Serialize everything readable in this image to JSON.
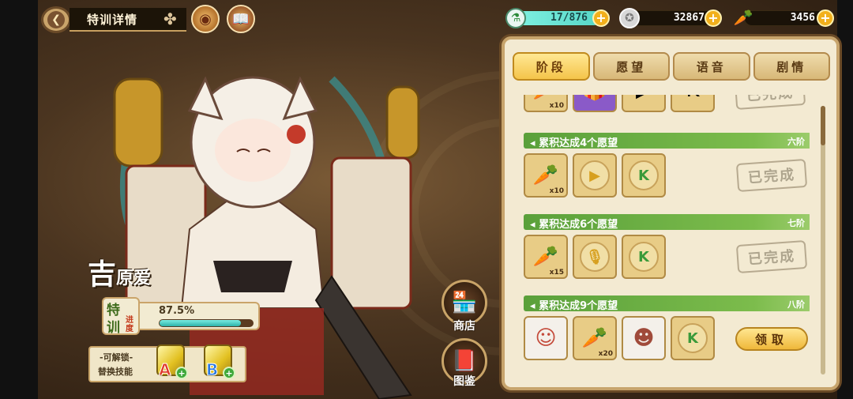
{
  "header": {
    "back_icon": "back-arrow-icon",
    "title": "特训详情",
    "icons": [
      "clover-icon",
      "eye-emblem-icon",
      "book-icon"
    ]
  },
  "currency": {
    "stamina": {
      "icon": "potion-icon",
      "value": "17/876"
    },
    "coin": {
      "icon": "silver-coin-icon",
      "value": "32867"
    },
    "carrot": {
      "icon": "carrot-icon",
      "value": "3456"
    }
  },
  "character": {
    "name_big": "吉",
    "name_small": "原爱",
    "progress_tag_1": "特",
    "progress_tag_2": "训",
    "progress_tag_3": "进度",
    "progress_text": "87.5%",
    "progress_value": 0.875
  },
  "unlock": {
    "line1": "-可解锁-",
    "line2": "替换技能",
    "skills": [
      {
        "letter": "A",
        "color": "#e03a2a"
      },
      {
        "letter": "B",
        "color": "#2a78e0"
      }
    ]
  },
  "side_buttons": {
    "shop_label": "商店",
    "gallery_label": "图鉴"
  },
  "tabs": [
    "阶段",
    "愿望",
    "语音",
    "剧情"
  ],
  "active_tab": 0,
  "stages": [
    {
      "title": "累积达成4个愿望",
      "stage": "六阶",
      "items": [
        {
          "icon": "carrot-icon",
          "count": "x10",
          "glyph": "🥕"
        },
        {
          "icon": "play-icon",
          "count": "",
          "glyph": "▶"
        },
        {
          "icon": "k-badge-icon",
          "count": "",
          "glyph": "K"
        }
      ],
      "status": "已完成"
    },
    {
      "title": "累积达成6个愿望",
      "stage": "七阶",
      "items": [
        {
          "icon": "carrot-icon",
          "count": "x15",
          "glyph": "🥕"
        },
        {
          "icon": "microphone-icon",
          "count": "",
          "glyph": "🎙"
        },
        {
          "icon": "k-badge-icon",
          "count": "",
          "glyph": "K"
        }
      ],
      "status": "已完成"
    },
    {
      "title": "累积达成9个愿望",
      "stage": "八阶",
      "items": [
        {
          "icon": "character-portrait-icon",
          "count": "",
          "glyph": "☺"
        },
        {
          "icon": "carrot-icon",
          "count": "x20",
          "glyph": "🥕"
        },
        {
          "icon": "chibi-character-icon",
          "count": "",
          "glyph": "☻"
        },
        {
          "icon": "k-badge-icon",
          "count": "",
          "glyph": "K"
        }
      ],
      "action": "领取"
    }
  ],
  "partial_top_row": [
    {
      "count": "x10"
    }
  ]
}
